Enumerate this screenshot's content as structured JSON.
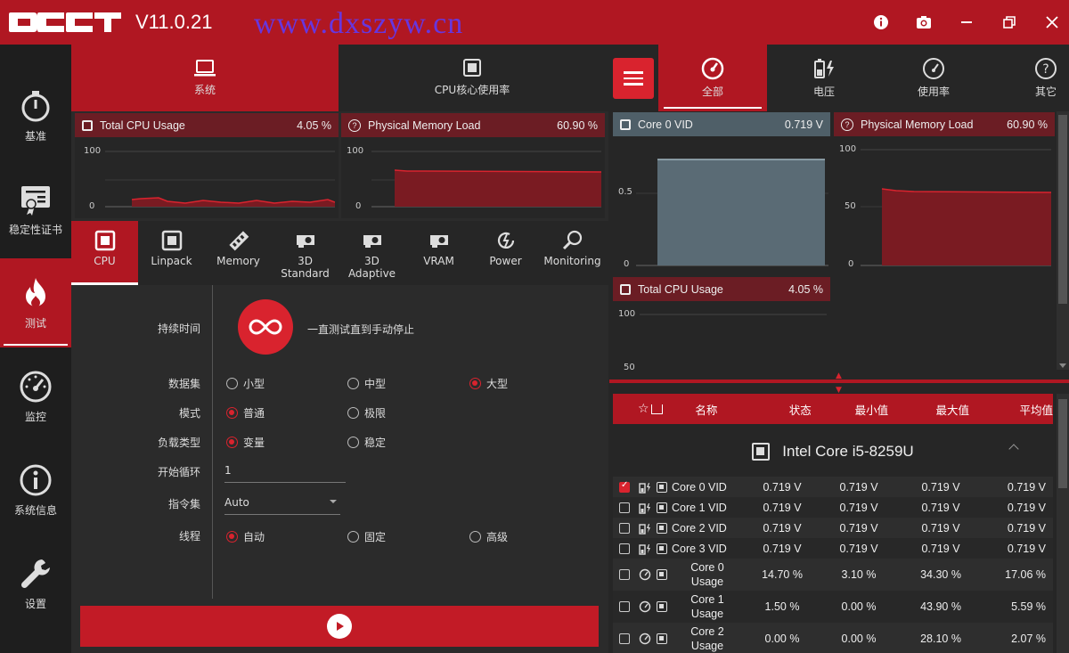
{
  "app": {
    "version": "V11.0.21",
    "watermark": "www.dxszyw.cn"
  },
  "colors": {
    "accent": "#b01722",
    "accent_bright": "#d9232e",
    "chart_fill": "#7a1b22",
    "vid_fill": "#5a6b75"
  },
  "titlebar_icons": [
    "info-icon",
    "camera-icon",
    "minimize-icon",
    "restore-icon",
    "close-icon"
  ],
  "leftnav": [
    {
      "label": "基准",
      "icon": "stopwatch-icon"
    },
    {
      "label": "稳定性证书",
      "icon": "certificate-icon"
    },
    {
      "label": "测试",
      "icon": "flame-icon",
      "active": true
    },
    {
      "label": "监控",
      "icon": "gauge-icon"
    },
    {
      "label": "系统信息",
      "icon": "info-circle-icon"
    },
    {
      "label": "设置",
      "icon": "wrench-icon"
    }
  ],
  "midtabs": [
    {
      "label": "系统",
      "icon": "laptop-icon",
      "active": true
    },
    {
      "label": "CPU核心使用率",
      "icon": "chip-icon"
    }
  ],
  "mini_graphs": {
    "cpu": {
      "title": "Total CPU Usage",
      "value": "4.05 %",
      "max": "100",
      "min": "0"
    },
    "mem": {
      "title": "Physical Memory Load",
      "value": "60.90 %",
      "max": "100",
      "min": "0"
    }
  },
  "test_tabs": [
    {
      "label": "CPU",
      "icon": "chip-icon",
      "active": true
    },
    {
      "label": "Linpack",
      "icon": "chip-icon"
    },
    {
      "label": "Memory",
      "icon": "memory-icon"
    },
    {
      "label": "3D\nStandard",
      "icon": "gpu-icon"
    },
    {
      "label": "3D\nAdaptive",
      "icon": "gpu-icon"
    },
    {
      "label": "VRAM",
      "icon": "gpu-icon"
    },
    {
      "label": "Power",
      "icon": "power-icon"
    },
    {
      "label": "Monitoring",
      "icon": "magnifier-icon"
    }
  ],
  "form": {
    "duration_label": "持续时间",
    "duration_text": "一直测试直到手动停止",
    "dataset_label": "数据集",
    "dataset_options": [
      "小型",
      "中型",
      "大型"
    ],
    "mode_label": "模式",
    "mode_options": [
      "普通",
      "极限"
    ],
    "load_label": "负载类型",
    "load_options": [
      "变量",
      "稳定"
    ],
    "cycle_label": "开始循环",
    "cycle_value": "1",
    "instr_label": "指令集",
    "instr_value": "Auto",
    "thread_label": "线程",
    "thread_options": [
      "自动",
      "固定",
      "高级"
    ]
  },
  "right_tabs": [
    {
      "label": "全部",
      "icon": "dashboard-icon",
      "active": true
    },
    {
      "label": "电压",
      "icon": "battery-bolt-icon"
    },
    {
      "label": "使用率",
      "icon": "gauge-icon"
    },
    {
      "label": "其它",
      "icon": "question-icon"
    }
  ],
  "right_graphs": {
    "vid": {
      "title": "Core 0 VID",
      "value": "0.719 V",
      "max": "0.5",
      "min": "0"
    },
    "mem": {
      "title": "Physical Memory Load",
      "value": "60.90 %",
      "max": "100",
      "mid": "50",
      "min": "0"
    },
    "cpu": {
      "title": "Total CPU Usage",
      "value": "4.05 %",
      "max": "100",
      "min": "50"
    }
  },
  "table": {
    "headers": [
      "名称",
      "状态",
      "最小值",
      "最大值",
      "平均值"
    ],
    "cpu": "Intel Core i5-8259U",
    "rows": [
      {
        "name": "Core 0 VID",
        "status": "0.719 V",
        "min": "0.719 V",
        "max": "0.719 V",
        "avg": "0.719 V",
        "checked": true,
        "type": "volt"
      },
      {
        "name": "Core 1 VID",
        "status": "0.719 V",
        "min": "0.719 V",
        "max": "0.719 V",
        "avg": "0.719 V",
        "checked": false,
        "type": "volt"
      },
      {
        "name": "Core 2 VID",
        "status": "0.719 V",
        "min": "0.719 V",
        "max": "0.719 V",
        "avg": "0.719 V",
        "checked": false,
        "type": "volt"
      },
      {
        "name": "Core 3 VID",
        "status": "0.719 V",
        "min": "0.719 V",
        "max": "0.719 V",
        "avg": "0.719 V",
        "checked": false,
        "type": "volt"
      },
      {
        "name": "Core 0\nUsage",
        "status": "14.70 %",
        "min": "3.10 %",
        "max": "34.30 %",
        "avg": "17.06 %",
        "checked": false,
        "type": "usage"
      },
      {
        "name": "Core 1\nUsage",
        "status": "1.50 %",
        "min": "0.00 %",
        "max": "43.90 %",
        "avg": "5.59 %",
        "checked": false,
        "type": "usage"
      },
      {
        "name": "Core 2\nUsage",
        "status": "0.00 %",
        "min": "0.00 %",
        "max": "28.10 %",
        "avg": "2.07 %",
        "checked": false,
        "type": "usage"
      }
    ]
  }
}
